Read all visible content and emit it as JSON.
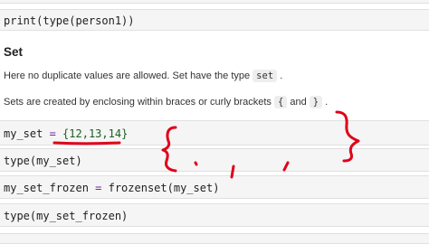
{
  "top_partial_text": "(                                                    )",
  "code_print": "print(type(person1))",
  "section_title": "Set",
  "para1": {
    "before": "Here no duplicate values are allowed. Set have the type ",
    "code": "set",
    "after": " ."
  },
  "para2": {
    "before": "Sets are created by enclosing within braces or curly brackets ",
    "open": "{",
    "mid": " and ",
    "close": "}",
    "after": " ."
  },
  "code_line1": {
    "var": "my_set",
    "eq": " = ",
    "open": "{",
    "values": "12,13,14",
    "close": "}"
  },
  "code_line2": "type(my_set)",
  "code_line3": {
    "lhs": "my_set_frozen",
    "eq": " = ",
    "rhs": "frozenset(my_set)"
  },
  "code_line4": "type(my_set_frozen)",
  "annotation_color": "#e0001a"
}
